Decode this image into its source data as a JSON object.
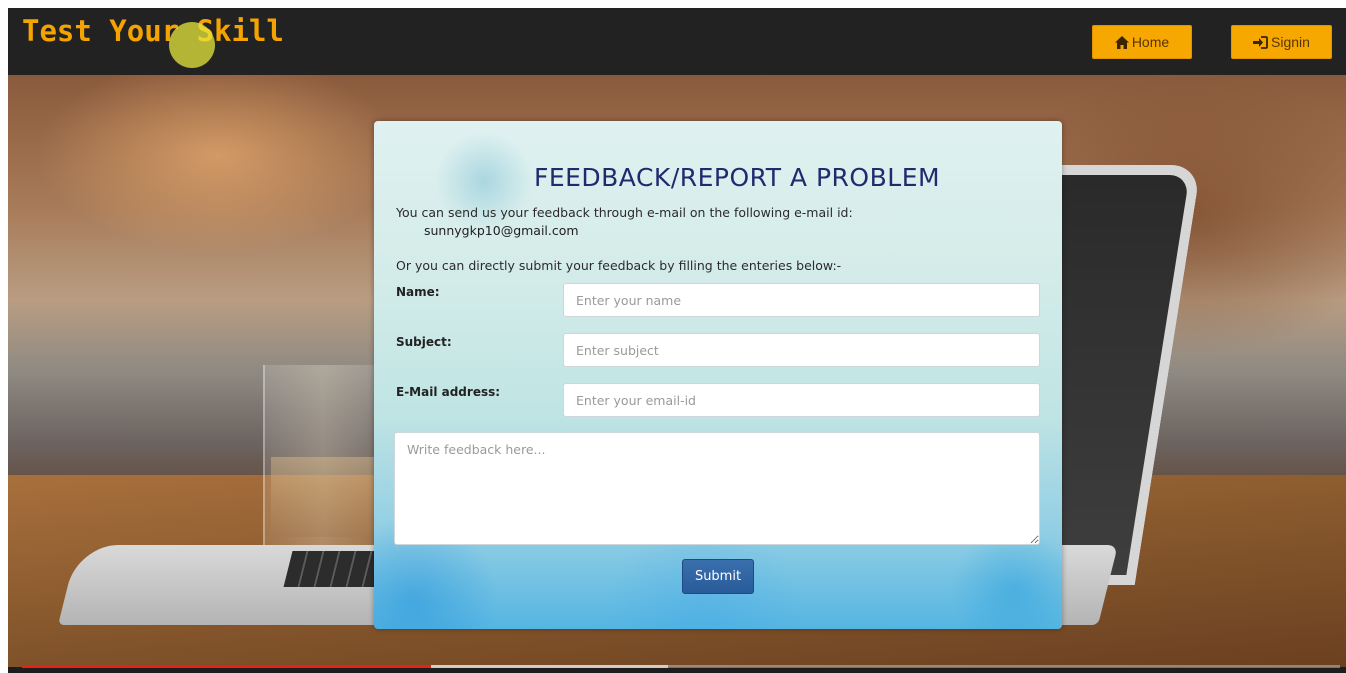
{
  "navbar": {
    "brand": "Test Your Skill",
    "home_label": "Home",
    "signin_label": "Signin",
    "home_icon": "home-icon",
    "signin_icon": "sign-in-icon",
    "button_color": "#f7a800",
    "brand_color": "#f4a300"
  },
  "feedback": {
    "title": "FEEDBACK/REPORT A PROBLEM",
    "intro": "You can send us your feedback through e-mail on the following e-mail id:",
    "email": "sunnygkp10@gmail.com",
    "alt_intro": "Or you can directly submit your feedback by filling the enteries below:-",
    "fields": {
      "name": {
        "label": "Name:",
        "placeholder": "Enter your name"
      },
      "subject": {
        "label": "Subject:",
        "placeholder": "Enter subject"
      },
      "email": {
        "label": "E-Mail address:",
        "placeholder": "Enter your email-id"
      }
    },
    "message_placeholder": "Write feedback here...",
    "submit_label": "Submit",
    "submit_color": "#285b98",
    "title_color": "#1e2c6e"
  },
  "video": {
    "played_fraction": 0.31,
    "buffered_fraction": 0.49,
    "progress_color": "#e62117"
  }
}
